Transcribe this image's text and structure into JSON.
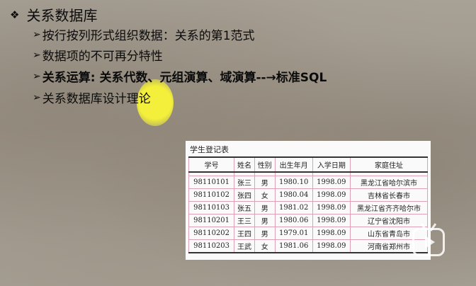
{
  "slide": {
    "heading": "关系数据库",
    "points": [
      "按行按列形式组织数据：关系的第1范式",
      "数据项的不可再分特性",
      "关系运算: 关系代数、元组演算、域演算--→标准SQL",
      "关系数据库设计理论"
    ]
  },
  "table": {
    "title": "学生登记表",
    "headers": [
      "学号",
      "姓名",
      "性别",
      "出生年月",
      "入学日期",
      "家庭住址"
    ],
    "rows": [
      [
        "98110101",
        "张三",
        "男",
        "1980.10",
        "1998.09",
        "黑龙江省哈尔滨市"
      ],
      [
        "98110102",
        "张四",
        "女",
        "1980.04",
        "1998.09",
        "吉林省长春市"
      ],
      [
        "98110103",
        "张五",
        "男",
        "1981.02",
        "1998.09",
        "黑龙江省齐齐哈尔市"
      ],
      [
        "98110201",
        "王三",
        "男",
        "1980.06",
        "1998.09",
        "辽宁省沈阳市"
      ],
      [
        "98110202",
        "王四",
        "男",
        "1979.01",
        "1998.09",
        "山东省青岛市"
      ],
      [
        "98110203",
        "王武",
        "女",
        "1981.06",
        "1998.09",
        "河南省郑州市"
      ]
    ]
  },
  "icons": {
    "heading_bullet": "diamond-bullet-icon",
    "point_bullet": "arrow-bullet-icon",
    "watermark": "bilibili-tv-icon"
  },
  "colors": {
    "highlight": "#f3ef3a",
    "table_border": "#e0a0b8"
  }
}
